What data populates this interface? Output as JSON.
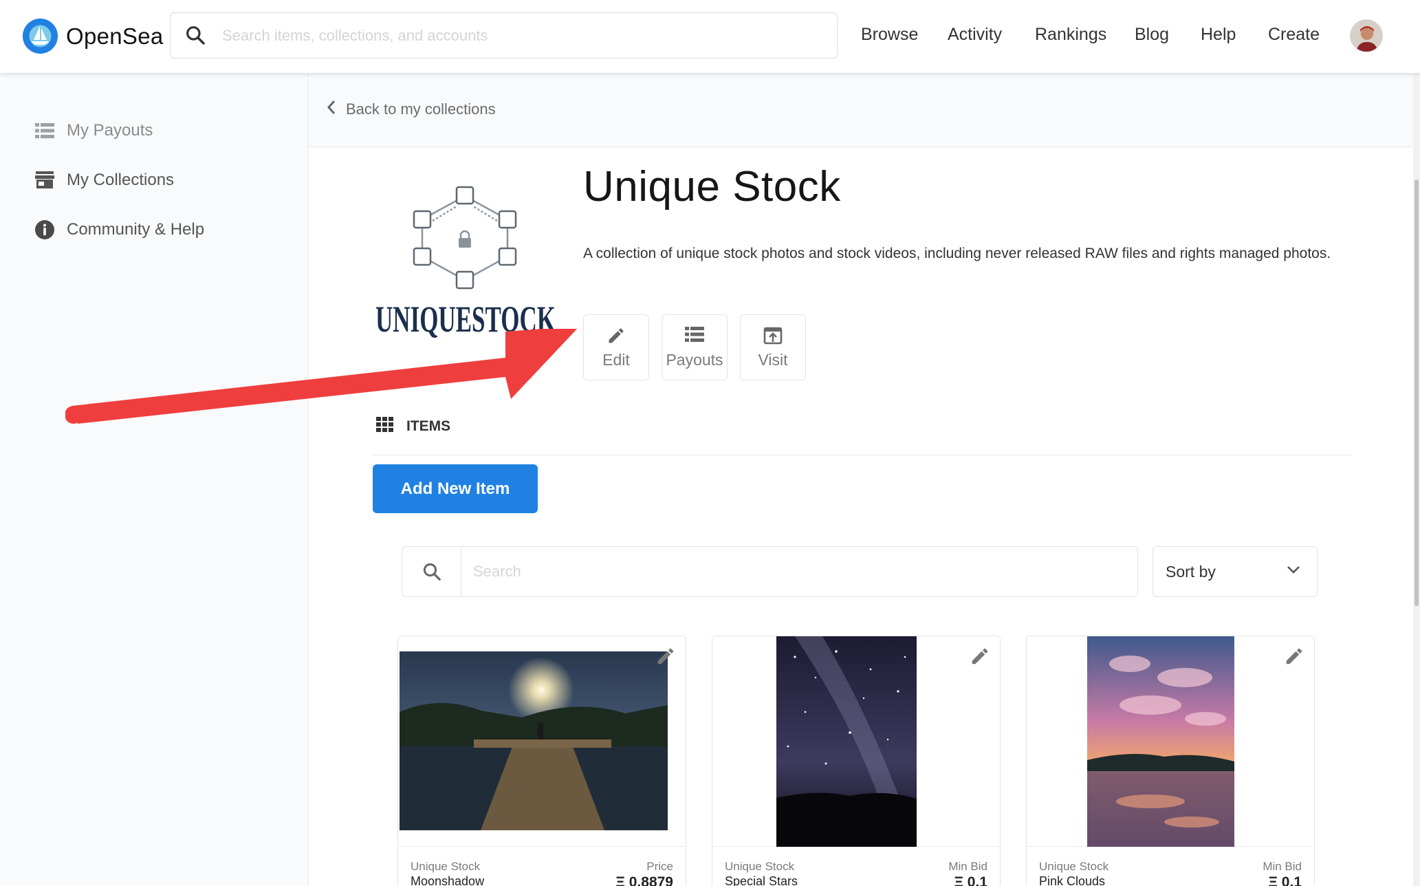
{
  "header": {
    "brand": "OpenSea",
    "search_placeholder": "Search items, collections, and accounts",
    "nav": [
      "Browse",
      "Activity",
      "Rankings",
      "Blog",
      "Help",
      "Create"
    ]
  },
  "sidebar": {
    "items": [
      {
        "label": "My Payouts",
        "icon": "list-icon"
      },
      {
        "label": "My Collections",
        "icon": "storefront-icon"
      },
      {
        "label": "Community & Help",
        "icon": "info-icon"
      }
    ]
  },
  "main": {
    "back_label": "Back to my collections",
    "collection": {
      "title": "Unique Stock",
      "description": "A collection of unique stock photos and stock videos, including never released RAW files and rights managed photos.",
      "logo_text": "UNIQUESTOCK"
    },
    "actions": [
      {
        "label": "Edit",
        "icon": "pencil-icon"
      },
      {
        "label": "Payouts",
        "icon": "list-icon"
      },
      {
        "label": "Visit",
        "icon": "external-link-icon"
      }
    ],
    "items_heading": "ITEMS",
    "add_button": "Add New Item",
    "search_placeholder": "Search",
    "sort_label": "Sort by",
    "cards": [
      {
        "collection": "Unique Stock",
        "name": "Moonshadow",
        "price_label": "Price",
        "price": "Ξ 0.8879"
      },
      {
        "collection": "Unique Stock",
        "name": "Special Stars",
        "price_label": "Min Bid",
        "price": "Ξ 0.1"
      },
      {
        "collection": "Unique Stock",
        "name": "Pink Clouds",
        "price_label": "Min Bid",
        "price": "Ξ 0.1"
      }
    ]
  },
  "colors": {
    "accent": "#2081e2",
    "annotation_arrow": "#ef3e3e",
    "sidebar_bg": "#f9fafc"
  }
}
